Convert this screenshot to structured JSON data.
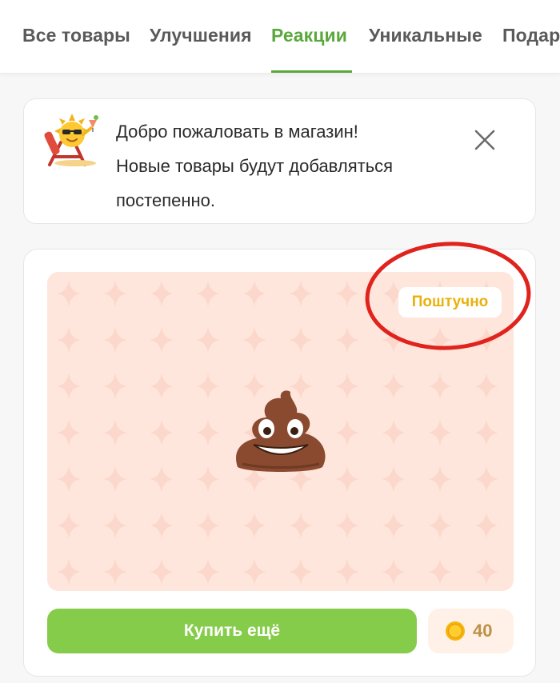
{
  "tabs": [
    {
      "label": "Все товары"
    },
    {
      "label": "Улучшения"
    },
    {
      "label": "Реакции"
    },
    {
      "label": "Уникальные"
    },
    {
      "label": "Подар"
    }
  ],
  "active_tab_index": 2,
  "welcome": {
    "line1": "Добро пожаловать в магазин!",
    "line2": "Новые товары будут добавляться",
    "line3": "постепенно.",
    "mascot_icon": "sun-mascot-sunglasses-icon",
    "close_icon": "close-icon"
  },
  "product": {
    "badge": "Поштучно",
    "item_icon": "pile-of-poo-emoji-icon",
    "buy_label": "Купить ещё",
    "price": "40",
    "coin_icon": "coin-icon"
  },
  "colors": {
    "accent_green": "#5aa83b",
    "button_green": "#85cc4a",
    "preview_background": "#ffe6dc",
    "badge_text": "#e8b10c",
    "annotation_red": "#e0231c"
  }
}
